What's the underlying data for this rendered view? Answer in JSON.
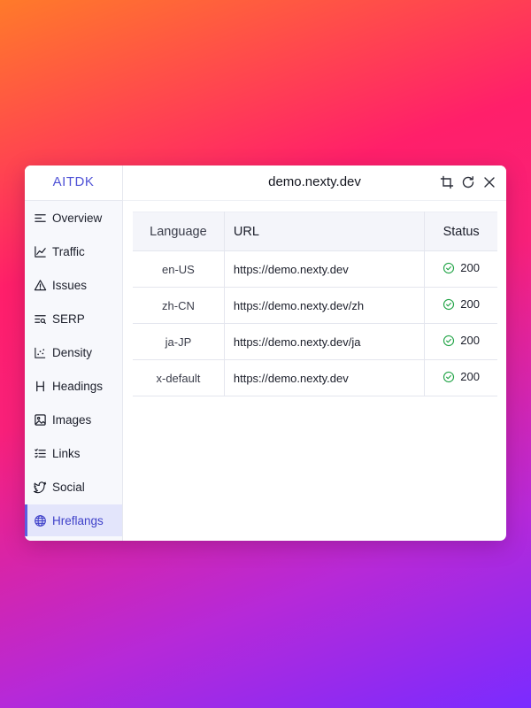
{
  "brand": "AITDK",
  "domain": "demo.nexty.dev",
  "colors": {
    "accent": "#4f52d6",
    "success": "#22a447",
    "active_bg": "#e3e5fb"
  },
  "toolbar": [
    {
      "name": "crop-icon"
    },
    {
      "name": "refresh-icon"
    },
    {
      "name": "close-icon"
    }
  ],
  "sidebar": {
    "items": [
      {
        "label": "Overview",
        "icon": "overview-icon",
        "active": false
      },
      {
        "label": "Traffic",
        "icon": "chart-line-icon",
        "active": false
      },
      {
        "label": "Issues",
        "icon": "warning-triangle-icon",
        "active": false
      },
      {
        "label": "SERP",
        "icon": "serp-search-icon",
        "active": false
      },
      {
        "label": "Density",
        "icon": "scatter-icon",
        "active": false
      },
      {
        "label": "Headings",
        "icon": "heading-icon",
        "active": false
      },
      {
        "label": "Images",
        "icon": "image-icon",
        "active": false
      },
      {
        "label": "Links",
        "icon": "list-icon",
        "active": false
      },
      {
        "label": "Social",
        "icon": "twitter-bird-icon",
        "active": false
      },
      {
        "label": "Hreflangs",
        "icon": "globe-icon",
        "active": true
      }
    ]
  },
  "table": {
    "headers": {
      "language": "Language",
      "url": "URL",
      "status": "Status"
    },
    "rows": [
      {
        "language": "en-US",
        "url": "https://demo.nexty.dev",
        "status": "200"
      },
      {
        "language": "zh-CN",
        "url": "https://demo.nexty.dev/zh",
        "status": "200"
      },
      {
        "language": "ja-JP",
        "url": "https://demo.nexty.dev/ja",
        "status": "200"
      },
      {
        "language": "x-default",
        "url": "https://demo.nexty.dev",
        "status": "200"
      }
    ]
  }
}
